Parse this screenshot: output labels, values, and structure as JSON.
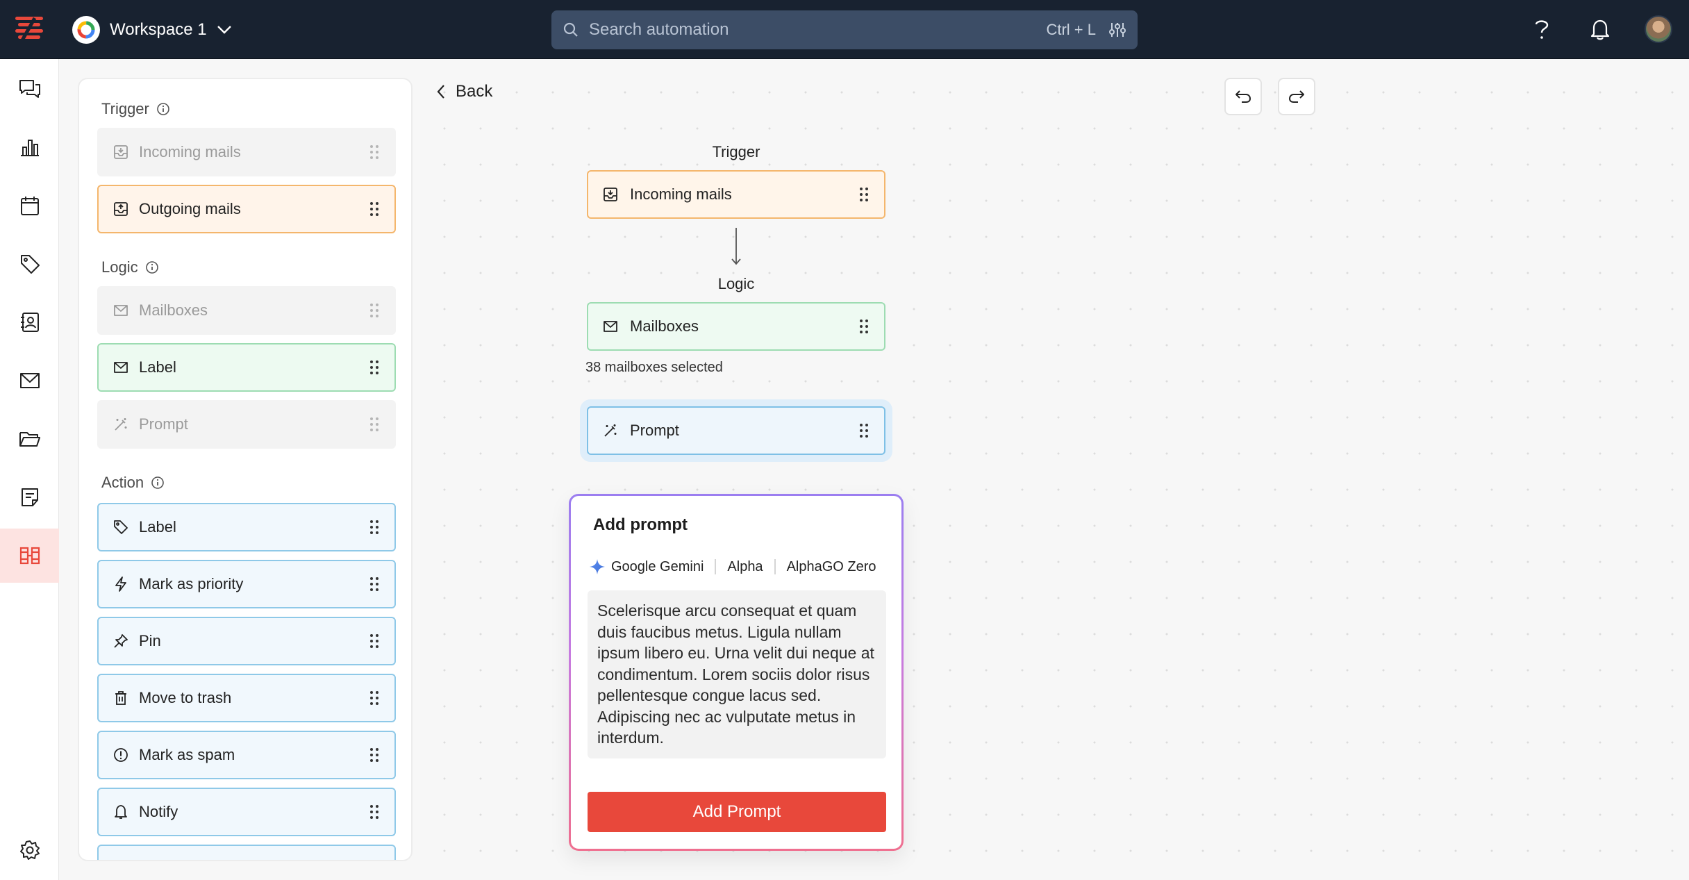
{
  "topbar": {
    "workspace_name": "Workspace 1",
    "search_placeholder": "Search automation",
    "search_shortcut": "Ctrl + L"
  },
  "rail": {
    "items": [
      "chat-icon",
      "analytics-icon",
      "calendar-icon",
      "tag-icon",
      "contacts-icon",
      "mail-icon",
      "folder-icon",
      "notes-icon",
      "automation-icon"
    ],
    "active": "automation-icon",
    "footer": "settings-icon"
  },
  "palette": {
    "trigger": {
      "heading": "Trigger",
      "items": [
        {
          "label": "Incoming mails",
          "state": "disabled",
          "icon": "inbox-download-icon"
        },
        {
          "label": "Outgoing mails",
          "state": "active",
          "icon": "inbox-upload-icon"
        }
      ]
    },
    "logic": {
      "heading": "Logic",
      "items": [
        {
          "label": "Mailboxes",
          "state": "disabled",
          "icon": "mail-icon"
        },
        {
          "label": "Label",
          "state": "active",
          "icon": "mail-icon"
        },
        {
          "label": "Prompt",
          "state": "disabled",
          "icon": "magic-wand-icon"
        }
      ]
    },
    "action": {
      "heading": "Action",
      "items": [
        {
          "label": "Label",
          "icon": "tag-icon"
        },
        {
          "label": "Mark as priority",
          "icon": "lightning-icon"
        },
        {
          "label": "Pin",
          "icon": "pin-icon"
        },
        {
          "label": "Move to trash",
          "icon": "trash-icon"
        },
        {
          "label": "Mark as spam",
          "icon": "alert-icon"
        },
        {
          "label": "Notify",
          "icon": "bell-icon"
        }
      ]
    }
  },
  "canvas": {
    "back_label": "Back",
    "flow": {
      "trigger_label": "Trigger",
      "trigger_node": "Incoming mails",
      "logic_label": "Logic",
      "logic_node": "Mailboxes",
      "logic_meta": "38 mailboxes selected",
      "prompt_node": "Prompt"
    },
    "popover": {
      "title": "Add prompt",
      "models": [
        "Google Gemini",
        "Alpha",
        "AlphaGO Zero"
      ],
      "prompt_text": "Scelerisque arcu consequat et quam duis faucibus metus. Ligula nullam ipsum libero eu. Urna velit dui neque at condimentum. Lorem sociis dolor risus pellentesque congue lacus sed. Adipiscing nec ac vulputate metus in interdum.",
      "button_label": "Add Prompt"
    }
  },
  "colors": {
    "topbar": "#182230",
    "accent_red": "#e8483b",
    "trigger_border": "#f4b66c",
    "logic_border": "#9ddcb2",
    "action_border": "#8fc9e8"
  }
}
